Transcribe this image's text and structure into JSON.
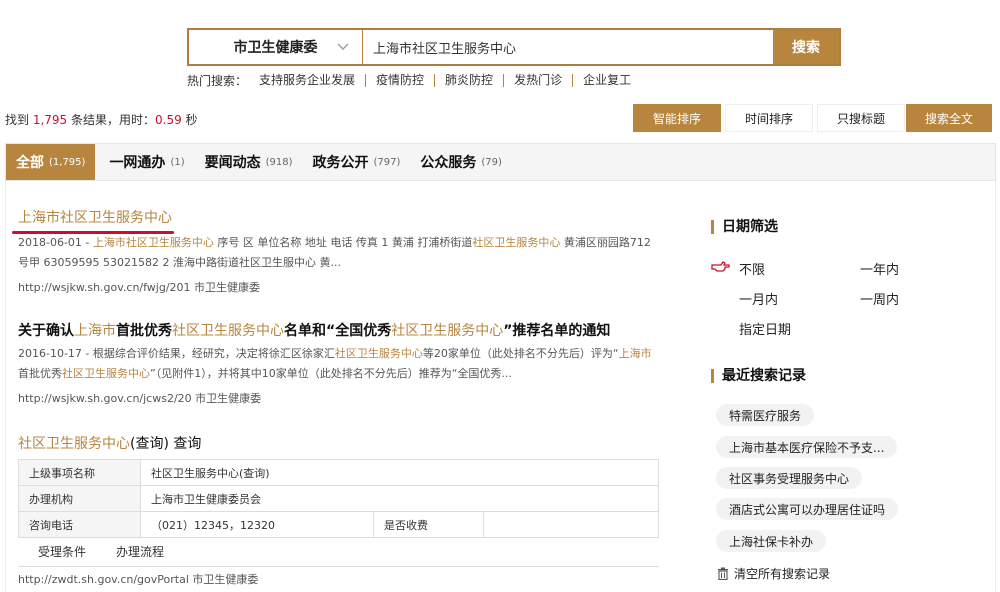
{
  "search": {
    "scope": "市卫生健康委",
    "query": "上海市社区卫生服务中心",
    "button": "搜索"
  },
  "hot": {
    "label": "热门搜索：",
    "items": [
      "支持服务企业发展",
      "疫情防控",
      "肺炎防控",
      "发热门诊",
      "企业复工"
    ]
  },
  "summary": {
    "prefix": "找到 ",
    "count": "1,795",
    "mid": " 条结果，用时：",
    "time": "0.59",
    "suffix": " 秒"
  },
  "sort": {
    "smart": "智能排序",
    "time": "时间排序",
    "title_only": "只搜标题",
    "fulltext": "搜索全文"
  },
  "tabs": [
    {
      "label": "全部",
      "count": "(1,795)"
    },
    {
      "label": "一网通办",
      "count": "(1)"
    },
    {
      "label": "要闻动态",
      "count": "(918)"
    },
    {
      "label": "政务公开",
      "count": "(797)"
    },
    {
      "label": "公众服务",
      "count": "(79)"
    }
  ],
  "results": [
    {
      "title": "上海市社区卫生服务中心",
      "date": "2018-06-01 - ",
      "s1": "上海市社区卫生服务中心",
      "s2": " 序号 区 单位名称 地址 电话 传真 1 黄浦 打浦桥街道",
      "s3": "社区卫生服务中心",
      "s4": " 黄浦区丽园路712号甲 63059595 53021582 2 淮海中路街道社区卫生服中心 黄...",
      "url": "http://wsjkw.sh.gov.cn/fwjg/201  市卫生健康委"
    },
    {
      "t1": "关于确认",
      "t2": "上海市",
      "t3": "首批优秀",
      "t4": "社区卫生服务中心",
      "t5": "名单和“全国优秀",
      "t6": "社区卫生服务中心",
      "t7": "”推荐名单的通知",
      "date": "2016-10-17 - ",
      "s1": "根据综合评价结果，经研究，决定将徐汇区徐家汇",
      "s2": "社区卫生服务中心",
      "s3": "等20家单位（此处排名不分先后）评为“",
      "s4": "上海市",
      "s5": "首批优秀",
      "s6": "社区卫生服务中心",
      "s7": "”（见附件1），并将其中10家单位（此处排名不分先后）推荐为“全国优秀...",
      "url": "http://wsjkw.sh.gov.cn/jcws2/20  市卫生健康委"
    },
    {
      "t1": "社区卫生服务中心",
      "t2": "(查询) 查询",
      "url": "http://zwdt.sh.gov.cn/govPortal  市卫生健康委"
    }
  ],
  "service": {
    "r1_label": "上级事项名称",
    "r1_value": "社区卫生服务中心(查询)",
    "r2_label": "办理机构",
    "r2_value": "上海市卫生健康委员会",
    "r3_label": "咨询电话",
    "r3_value": "（021）12345，12320",
    "r3_label2": "是否收费",
    "r3_value2": "",
    "tab1": "受理条件",
    "tab2": "办理流程"
  },
  "date_filter": {
    "title": "日期筛选",
    "unlimited": "不限",
    "one_year": "一年内",
    "one_month": "一月内",
    "one_week": "一周内",
    "custom": "指定日期"
  },
  "recent": {
    "title": "最近搜索记录",
    "items": [
      "特需医疗服务",
      "上海市基本医疗保险不予支...",
      "社区事务受理服务中心",
      "酒店式公寓可以办理居住证吗",
      "上海社保卡补办"
    ],
    "clear": "清空所有搜索记录"
  },
  "colors": {
    "accent": "#b8853f",
    "highlight_red": "#c8102e"
  }
}
